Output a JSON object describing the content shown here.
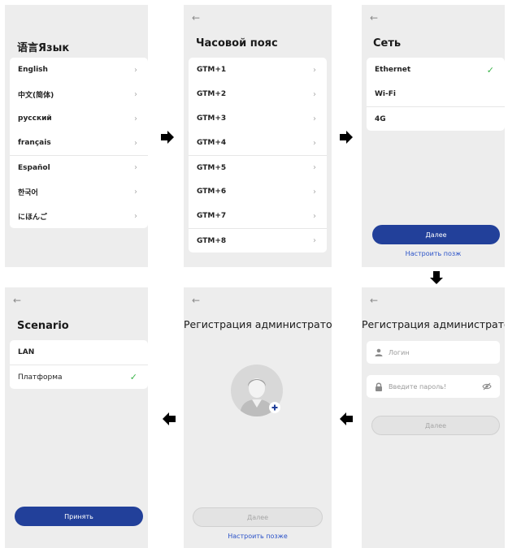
{
  "back_glyph": "←",
  "chevron_glyph": "›",
  "check_glyph": "✓",
  "language": {
    "title": "语言Язык",
    "items": [
      "English",
      "中文(简体)",
      "русский",
      "français",
      "Español",
      "한국어",
      "にほんご"
    ]
  },
  "timezone": {
    "title": "Часовой пояс",
    "items": [
      "GTM+1",
      "GTM+2",
      "GTM+3",
      "GTM+4",
      "GTM+5",
      "GTM+6",
      "GTM+7",
      "GTM+8"
    ]
  },
  "network": {
    "title": "Сеть",
    "items": [
      "Ethernet",
      "Wi-Fi",
      "4G"
    ],
    "next_label": "Далее",
    "later_label": "Настроить позж"
  },
  "scenario": {
    "title": "Scenario",
    "items": [
      "LAN",
      "Платформа"
    ],
    "accept_label": "Принять"
  },
  "admin_avatar": {
    "title": "Регистрация администратора",
    "next_label": "Далее",
    "later_label": "Настроить позже"
  },
  "admin_login": {
    "title": "Регистрация администратора",
    "login_placeholder": "Логин",
    "password_placeholder": "Введите пароль!",
    "next_label": "Далее"
  },
  "colors": {
    "primary": "#22409a",
    "link": "#2a52c8",
    "check": "#3bb54a",
    "panel_bg": "#ededed"
  }
}
